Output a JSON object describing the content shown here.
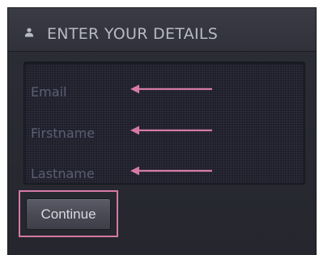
{
  "panel": {
    "header": {
      "icon": "user-icon",
      "title": "ENTER YOUR DETAILS"
    },
    "fields": [
      {
        "placeholder": "Email"
      },
      {
        "placeholder": "Firstname"
      },
      {
        "placeholder": "Lastname"
      }
    ],
    "continue_label": "Continue"
  },
  "colors": {
    "panel_background": "#2c2d36",
    "header_text": "#b7b9c4",
    "placeholder_text": "#5b5d73",
    "annotation_pink": "#d57aa6",
    "button_background": "#484953"
  }
}
